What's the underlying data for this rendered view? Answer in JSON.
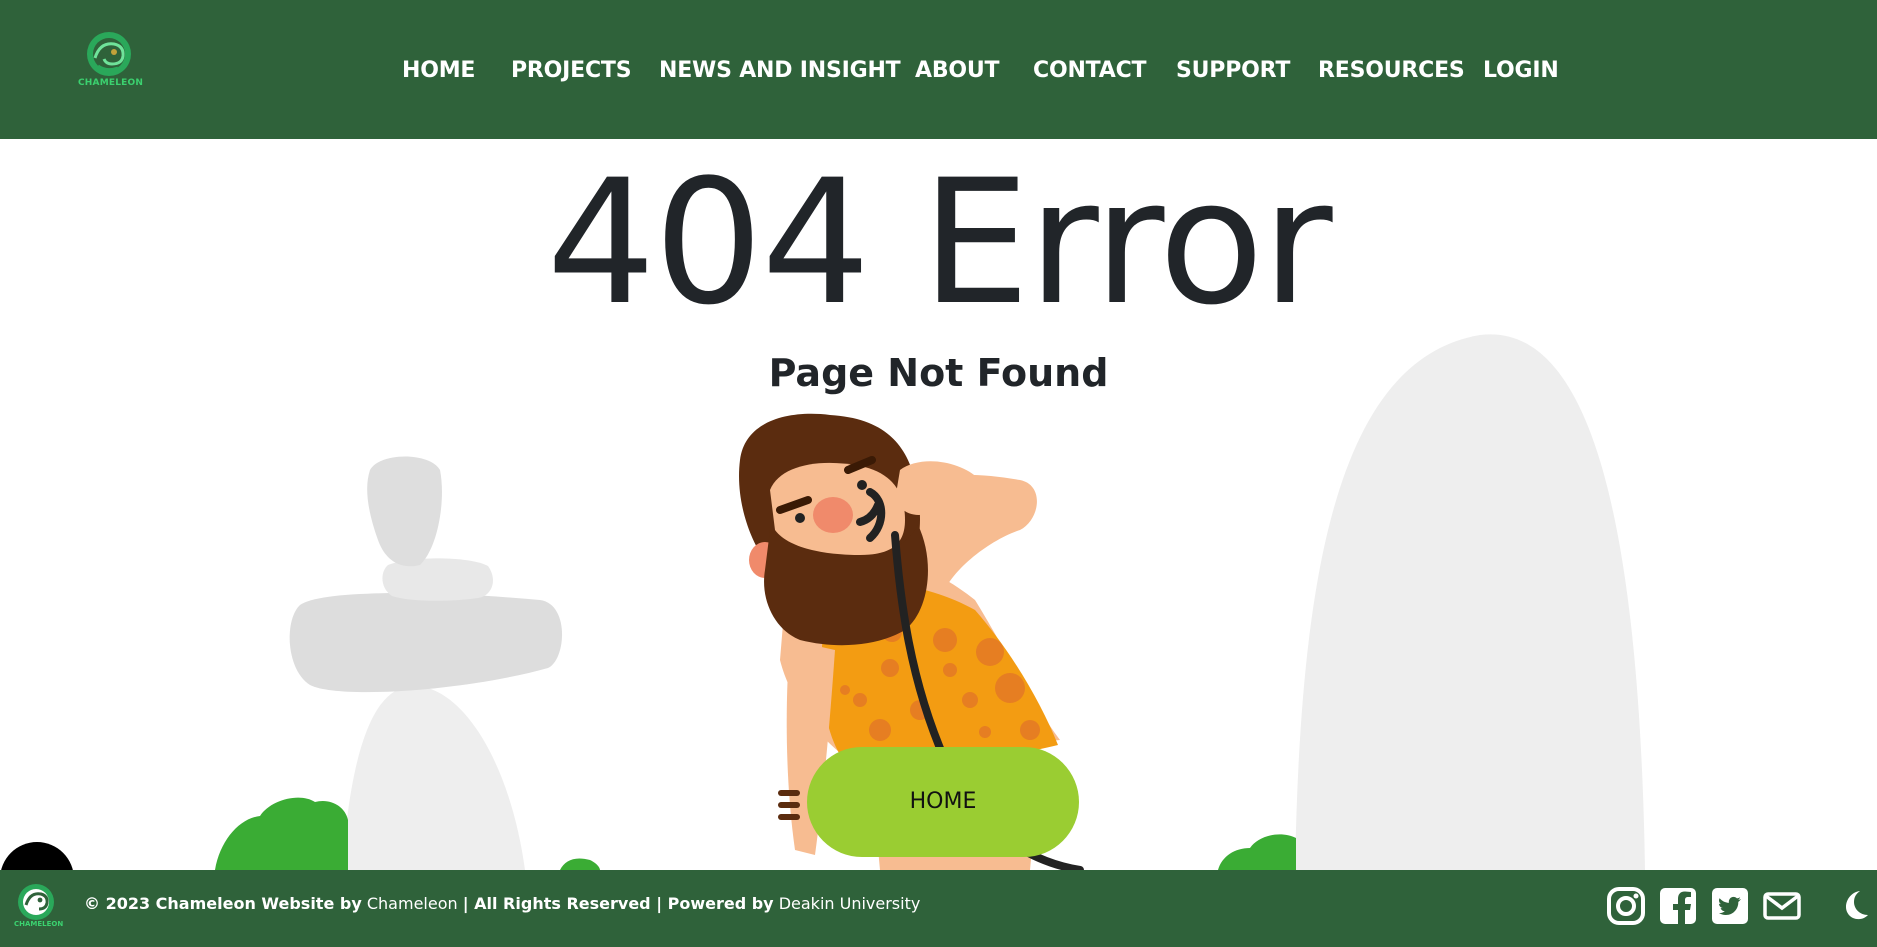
{
  "brand": {
    "logo_text": "CHAMELEON"
  },
  "nav": {
    "items": [
      {
        "label": "HOME"
      },
      {
        "label": "PROJECTS"
      },
      {
        "label": "NEWS AND INSIGHT"
      },
      {
        "label": "ABOUT"
      },
      {
        "label": "CONTACT"
      },
      {
        "label": "SUPPORT"
      },
      {
        "label": "RESOURCES"
      },
      {
        "label": "LOGIN"
      }
    ]
  },
  "main": {
    "title": "404 Error",
    "subtitle": "Page Not Found",
    "home_button": "HOME"
  },
  "footer": {
    "logo_text": "CHAMELEON",
    "copyright": "© 2023 Chameleon Website by",
    "author_link": "Chameleon",
    "rights": "| All Rights Reserved | Powered by",
    "university_link": "Deakin University",
    "social": [
      "instagram-icon",
      "facebook-icon",
      "twitter-icon",
      "email-icon"
    ],
    "theme_toggle_icon": "moon-icon"
  },
  "colors": {
    "header_bg": "#2f623a",
    "accent_green": "#9acd32",
    "logo_green": "#3bd16f",
    "text_dark": "#212529"
  }
}
